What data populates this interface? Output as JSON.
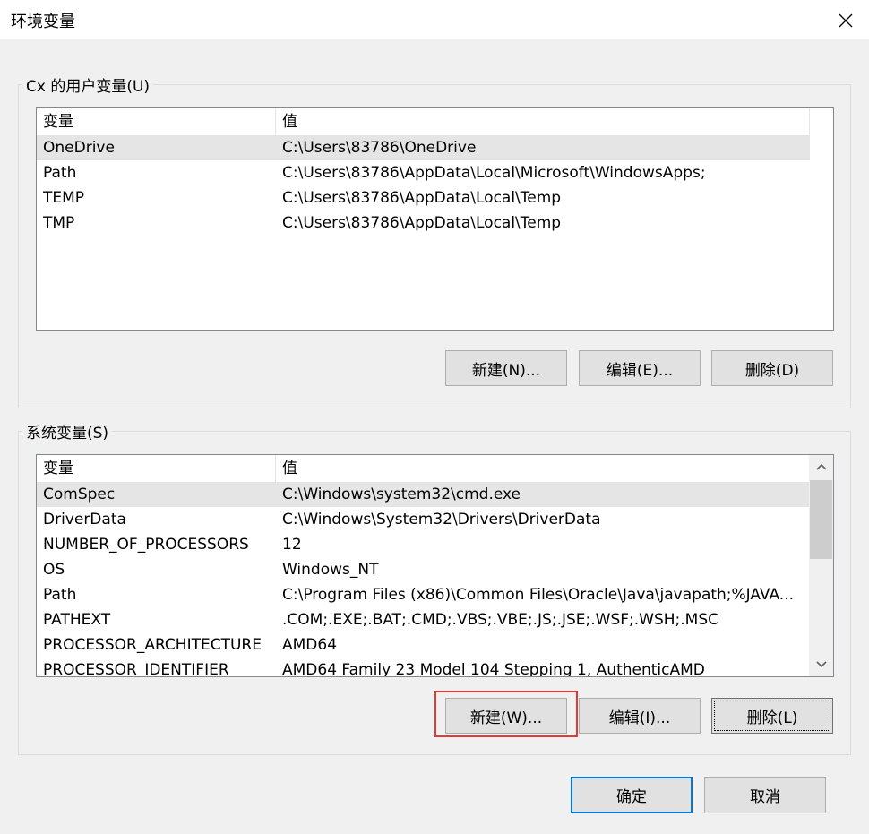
{
  "window": {
    "title": "环境变量",
    "close_icon": "close-icon"
  },
  "user_vars": {
    "group_label": "Cx 的用户变量(U)",
    "columns": [
      "变量",
      "值"
    ],
    "rows": [
      {
        "name": "OneDrive",
        "value": "C:\\Users\\83786\\OneDrive"
      },
      {
        "name": "Path",
        "value": "C:\\Users\\83786\\AppData\\Local\\Microsoft\\WindowsApps;"
      },
      {
        "name": "TEMP",
        "value": "C:\\Users\\83786\\AppData\\Local\\Temp"
      },
      {
        "name": "TMP",
        "value": "C:\\Users\\83786\\AppData\\Local\\Temp"
      }
    ],
    "selected_index": 0,
    "buttons": {
      "new": "新建(N)...",
      "edit": "编辑(E)...",
      "delete": "删除(D)"
    }
  },
  "system_vars": {
    "group_label": "系统变量(S)",
    "columns": [
      "变量",
      "值"
    ],
    "rows": [
      {
        "name": "ComSpec",
        "value": "C:\\Windows\\system32\\cmd.exe"
      },
      {
        "name": "DriverData",
        "value": "C:\\Windows\\System32\\Drivers\\DriverData"
      },
      {
        "name": "NUMBER_OF_PROCESSORS",
        "value": "12"
      },
      {
        "name": "OS",
        "value": "Windows_NT"
      },
      {
        "name": "Path",
        "value": "C:\\Program Files (x86)\\Common Files\\Oracle\\Java\\javapath;%JAVA..."
      },
      {
        "name": "PATHEXT",
        "value": ".COM;.EXE;.BAT;.CMD;.VBS;.VBE;.JS;.JSE;.WSF;.WSH;.MSC"
      },
      {
        "name": "PROCESSOR_ARCHITECTURE",
        "value": "AMD64"
      },
      {
        "name": "PROCESSOR_IDENTIFIER",
        "value": "AMD64 Family 23 Model 104 Stepping 1, AuthenticAMD"
      }
    ],
    "selected_index": 0,
    "buttons": {
      "new": "新建(W)...",
      "edit": "编辑(I)...",
      "delete": "删除(L)"
    }
  },
  "dialog_buttons": {
    "ok": "确定",
    "cancel": "取消"
  },
  "colors": {
    "accent": "#0078d7",
    "highlight": "#e53935",
    "selected_row": "#e5e5e5"
  }
}
